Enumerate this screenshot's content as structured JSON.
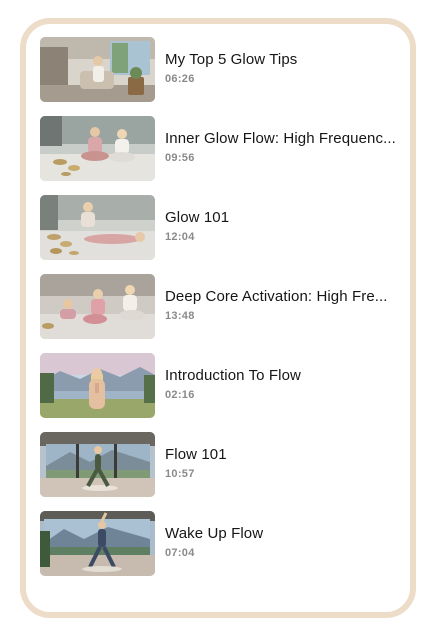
{
  "videos": [
    {
      "title": "My Top 5 Glow Tips",
      "duration": "06:26",
      "thumb_icon": "woman-seated-in-living-room-thumbnail"
    },
    {
      "title": "Inner Glow Flow: High Frequenc...",
      "duration": "09:56",
      "thumb_icon": "two-women-meditating-with-singing-bowls-thumbnail"
    },
    {
      "title": "Glow 101",
      "duration": "12:04",
      "thumb_icon": "sound-bath-session-thumbnail"
    },
    {
      "title": "Deep Core Activation: High Fre...",
      "duration": "13:48",
      "thumb_icon": "group-core-workout-thumbnail"
    },
    {
      "title": "Introduction To Flow",
      "duration": "02:16",
      "thumb_icon": "woman-prayer-hands-lake-thumbnail"
    },
    {
      "title": "Flow 101",
      "duration": "10:57",
      "thumb_icon": "yoga-pose-by-window-thumbnail"
    },
    {
      "title": "Wake Up Flow",
      "duration": "07:04",
      "thumb_icon": "standing-stretch-lake-view-thumbnail"
    }
  ],
  "colors": {
    "frame_border": "#eddcc8",
    "title_text": "#161616",
    "duration_text": "#8a8a8a"
  }
}
